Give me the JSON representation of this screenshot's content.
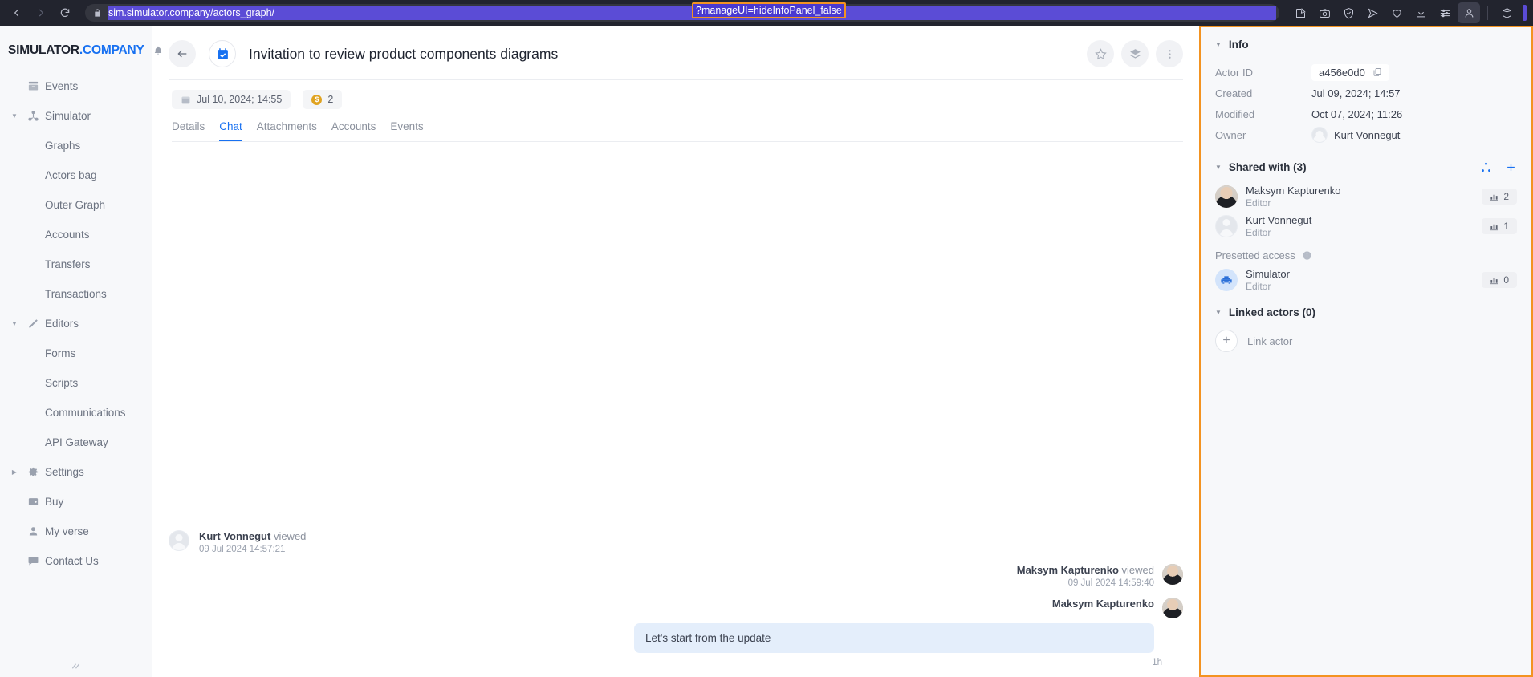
{
  "browser": {
    "back_icon": "chevron-left-icon",
    "forward_icon": "chevron-right-icon",
    "reload_icon": "reload-icon",
    "lock_icon": "lock-icon",
    "url": "sim.simulator.company/actors_graph/",
    "url_highlight": "?manageUI=hideInfoPanel_false",
    "highlight_color": "#f39321",
    "toolbar_icons": [
      "edit-icon",
      "camera-icon",
      "shield-check-icon",
      "send-icon",
      "heart-icon",
      "download-icon",
      "sliders-icon",
      "profile-icon",
      "cube-icon"
    ]
  },
  "sidebar": {
    "brand_primary": "SIMULATOR",
    "brand_secondary": ".COMPANY",
    "brand_accent": "#1871f1",
    "notification_icon": "bell-icon",
    "items": [
      {
        "label": "Events",
        "icon": "events-icon",
        "level": 0,
        "caret": ""
      },
      {
        "label": "Simulator",
        "icon": "graph-icon",
        "level": 0,
        "caret": "down"
      },
      {
        "label": "Graphs",
        "icon": "",
        "level": 1,
        "caret": ""
      },
      {
        "label": "Actors bag",
        "icon": "",
        "level": 1,
        "caret": ""
      },
      {
        "label": "Outer Graph",
        "icon": "",
        "level": 1,
        "caret": ""
      },
      {
        "label": "Accounts",
        "icon": "",
        "level": 1,
        "caret": ""
      },
      {
        "label": "Transfers",
        "icon": "",
        "level": 1,
        "caret": ""
      },
      {
        "label": "Transactions",
        "icon": "",
        "level": 1,
        "caret": ""
      },
      {
        "label": "Editors",
        "icon": "pencil-icon",
        "level": 0,
        "caret": "down"
      },
      {
        "label": "Forms",
        "icon": "",
        "level": 1,
        "caret": ""
      },
      {
        "label": "Scripts",
        "icon": "",
        "level": 1,
        "caret": ""
      },
      {
        "label": "Communications",
        "icon": "",
        "level": 1,
        "caret": ""
      },
      {
        "label": "API Gateway",
        "icon": "",
        "level": 1,
        "caret": ""
      },
      {
        "label": "Settings",
        "icon": "gear-icon",
        "level": 0,
        "caret": "right"
      },
      {
        "label": "Buy",
        "icon": "wallet-icon",
        "level": 0,
        "caret": ""
      },
      {
        "label": "My verse",
        "icon": "user-icon",
        "level": 0,
        "caret": ""
      },
      {
        "label": "Contact Us",
        "icon": "chat-icon",
        "level": 0,
        "caret": ""
      }
    ],
    "collapse_icon": "collapse-icon"
  },
  "header": {
    "back_icon": "arrow-left-icon",
    "doc_icon": "calendar-check-icon",
    "title": "Invitation to review product components diagrams",
    "actions": [
      "star-icon",
      "layers-icon",
      "more-vertical-icon"
    ],
    "chips": [
      {
        "icon": "calendar-icon",
        "label": "Jul 10, 2024; 14:55"
      },
      {
        "icon": "coin-icon",
        "label": "2"
      }
    ],
    "tabs": [
      {
        "label": "Details",
        "active": false
      },
      {
        "label": "Chat",
        "active": true
      },
      {
        "label": "Attachments",
        "active": false
      },
      {
        "label": "Accounts",
        "active": false
      },
      {
        "label": "Events",
        "active": false
      }
    ],
    "active_tab_color": "#1871f1"
  },
  "chat": {
    "events": [
      {
        "name": "Kurt Vonnegut",
        "action": "viewed",
        "time": "09 Jul 2024 14:57:21",
        "side": "left",
        "avatar": "generic"
      },
      {
        "name": "Maksym Kapturenko",
        "action": "viewed",
        "time": "09 Jul 2024 14:59:40",
        "side": "right",
        "avatar": "photo"
      }
    ],
    "message": {
      "name": "Maksym Kapturenko",
      "text": "Let's start from the update",
      "time": "1h",
      "avatar": "photo",
      "bubble_color": "#e4eefb"
    }
  },
  "info": {
    "title": "Info",
    "fields": [
      {
        "key": "Actor ID",
        "value": "a456e0d0",
        "copy_icon": "copy-icon"
      },
      {
        "key": "Created",
        "value": "Jul 09, 2024; 14:57"
      },
      {
        "key": "Modified",
        "value": "Oct 07, 2024; 11:26"
      },
      {
        "key": "Owner",
        "value": "Kurt Vonnegut"
      }
    ],
    "shared": {
      "title": "Shared with (3)",
      "actions": [
        "share-graph-icon",
        "add-icon"
      ],
      "people": [
        {
          "name": "Maksym Kapturenko",
          "role": "Editor",
          "count": "2",
          "avatar": "photo"
        },
        {
          "name": "Kurt Vonnegut",
          "role": "Editor",
          "count": "1",
          "avatar": "generic"
        }
      ]
    },
    "presetted": {
      "label": "Presetted access",
      "info_icon": "info-icon",
      "entries": [
        {
          "name": "Simulator",
          "role": "Editor",
          "count": "0",
          "avatar": "simulator"
        }
      ]
    },
    "linked": {
      "title": "Linked actors (0)",
      "add_label": "Link actor",
      "add_icon": "plus-icon"
    },
    "border_color": "#f39321"
  }
}
